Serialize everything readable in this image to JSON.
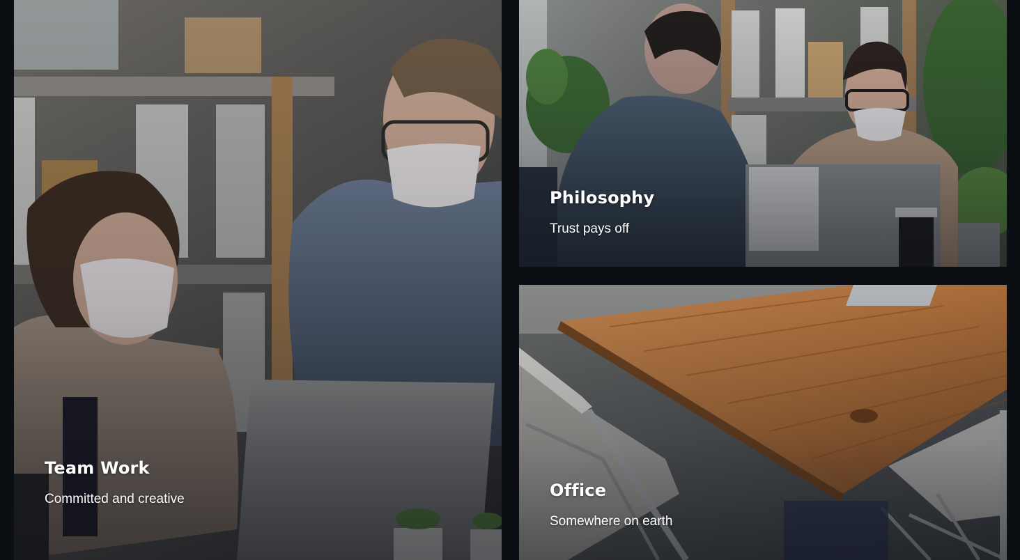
{
  "cards": [
    {
      "title": "Team Work",
      "subtitle": "Committed and creative",
      "image": "team-work-photo"
    },
    {
      "title": "Philosophy",
      "subtitle": "Trust pays off",
      "image": "philosophy-photo"
    },
    {
      "title": "Office",
      "subtitle": "Somewhere on earth",
      "image": "office-photo"
    }
  ],
  "colors": {
    "background": "#0b0e13",
    "caption_text": "#ffffff"
  }
}
